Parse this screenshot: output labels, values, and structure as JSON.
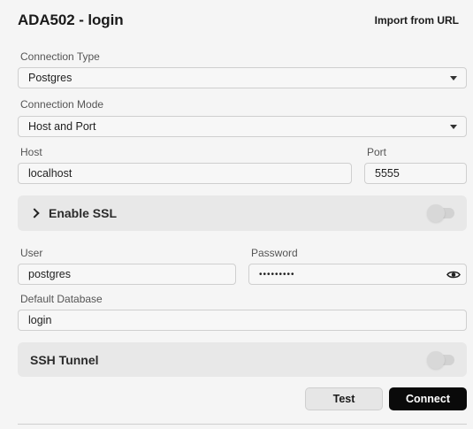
{
  "header": {
    "title": "ADA502 - login",
    "import_label": "Import from URL"
  },
  "connection_type": {
    "label": "Connection Type",
    "value": "Postgres"
  },
  "connection_mode": {
    "label": "Connection Mode",
    "value": "Host and Port"
  },
  "host": {
    "label": "Host",
    "value": "localhost"
  },
  "port": {
    "label": "Port",
    "value": "5555"
  },
  "ssl": {
    "label": "Enable SSL",
    "enabled": false
  },
  "user": {
    "label": "User",
    "value": "postgres"
  },
  "password": {
    "label": "Password",
    "value": "•••••••••"
  },
  "default_database": {
    "label": "Default Database",
    "value": "login"
  },
  "ssh": {
    "label": "SSH Tunnel",
    "enabled": false
  },
  "actions": {
    "test_label": "Test",
    "connect_label": "Connect"
  },
  "colors": {
    "background": "#f5f5f5",
    "panel": "#e8e8e8",
    "primary_button": "#0a0a0a",
    "secondary_button": "#e6e6e6"
  },
  "icons": {
    "connection_type_dropdown": "chevron-down-icon",
    "connection_mode_dropdown": "chevron-down-icon",
    "ssl_expand": "chevron-right-icon",
    "password_visibility": "eye-icon"
  }
}
